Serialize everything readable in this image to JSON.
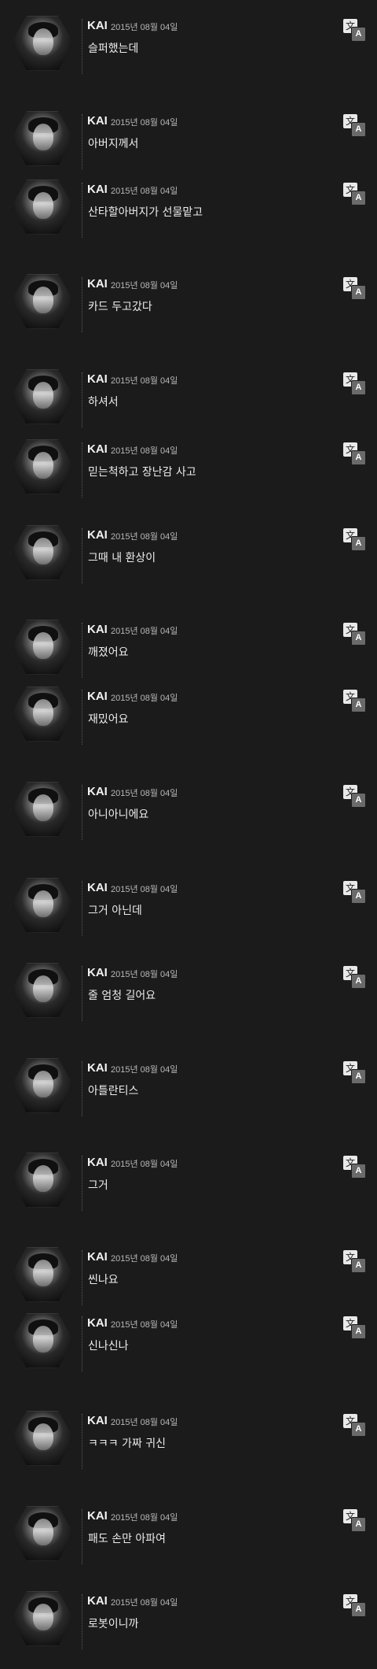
{
  "messages": [
    {
      "name": "KAI",
      "time": "2015년 08월 04일",
      "text": "슬퍼했는데",
      "translate_glyph": "文",
      "translate_letter": "A"
    },
    {
      "name": "KAI",
      "time": "2015년 08월 04일",
      "text": "아버지께서",
      "translate_glyph": "文",
      "translate_letter": "A"
    },
    {
      "name": "KAI",
      "time": "2015년 08월 04일",
      "text": "산타할아버지가 선물맡고",
      "translate_glyph": "文",
      "translate_letter": "A"
    },
    {
      "name": "KAI",
      "time": "2015년 08월 04일",
      "text": "카드 두고갔다",
      "translate_glyph": "文",
      "translate_letter": "A"
    },
    {
      "name": "KAI",
      "time": "2015년 08월 04일",
      "text": "하셔서",
      "translate_glyph": "文",
      "translate_letter": "A"
    },
    {
      "name": "KAI",
      "time": "2015년 08월 04일",
      "text": "믿는척하고 장난감 사고",
      "translate_glyph": "文",
      "translate_letter": "A"
    },
    {
      "name": "KAI",
      "time": "2015년 08월 04일",
      "text": "그때 내 환상이",
      "translate_glyph": "文",
      "translate_letter": "A"
    },
    {
      "name": "KAI",
      "time": "2015년 08월 04일",
      "text": "깨졌어요",
      "translate_glyph": "文",
      "translate_letter": "A"
    },
    {
      "name": "KAI",
      "time": "2015년 08월 04일",
      "text": "재밌어요",
      "translate_glyph": "文",
      "translate_letter": "A"
    },
    {
      "name": "KAI",
      "time": "2015년 08월 04일",
      "text": "아니아니에요",
      "translate_glyph": "文",
      "translate_letter": "A"
    },
    {
      "name": "KAI",
      "time": "2015년 08월 04일",
      "text": "그거 아닌데",
      "translate_glyph": "文",
      "translate_letter": "A"
    },
    {
      "name": "KAI",
      "time": "2015년 08월 04일",
      "text": "줄 엄청 길어요",
      "translate_glyph": "文",
      "translate_letter": "A"
    },
    {
      "name": "KAI",
      "time": "2015년 08월 04일",
      "text": "아틀란티스",
      "translate_glyph": "文",
      "translate_letter": "A"
    },
    {
      "name": "KAI",
      "time": "2015년 08월 04일",
      "text": "그거",
      "translate_glyph": "文",
      "translate_letter": "A"
    },
    {
      "name": "KAI",
      "time": "2015년 08월 04일",
      "text": "씬나요",
      "translate_glyph": "文",
      "translate_letter": "A"
    },
    {
      "name": "KAI",
      "time": "2015년 08월 04일",
      "text": "신나신나",
      "translate_glyph": "文",
      "translate_letter": "A"
    },
    {
      "name": "KAI",
      "time": "2015년 08월 04일",
      "text": "ㅋㅋㅋ 가짜 귀신",
      "translate_glyph": "文",
      "translate_letter": "A"
    },
    {
      "name": "KAI",
      "time": "2015년 08월 04일",
      "text": "패도 손만 아파여",
      "translate_glyph": "文",
      "translate_letter": "A"
    },
    {
      "name": "KAI",
      "time": "2015년 08월 04일",
      "text": "로봇이니까",
      "translate_glyph": "文",
      "translate_letter": "A"
    }
  ]
}
